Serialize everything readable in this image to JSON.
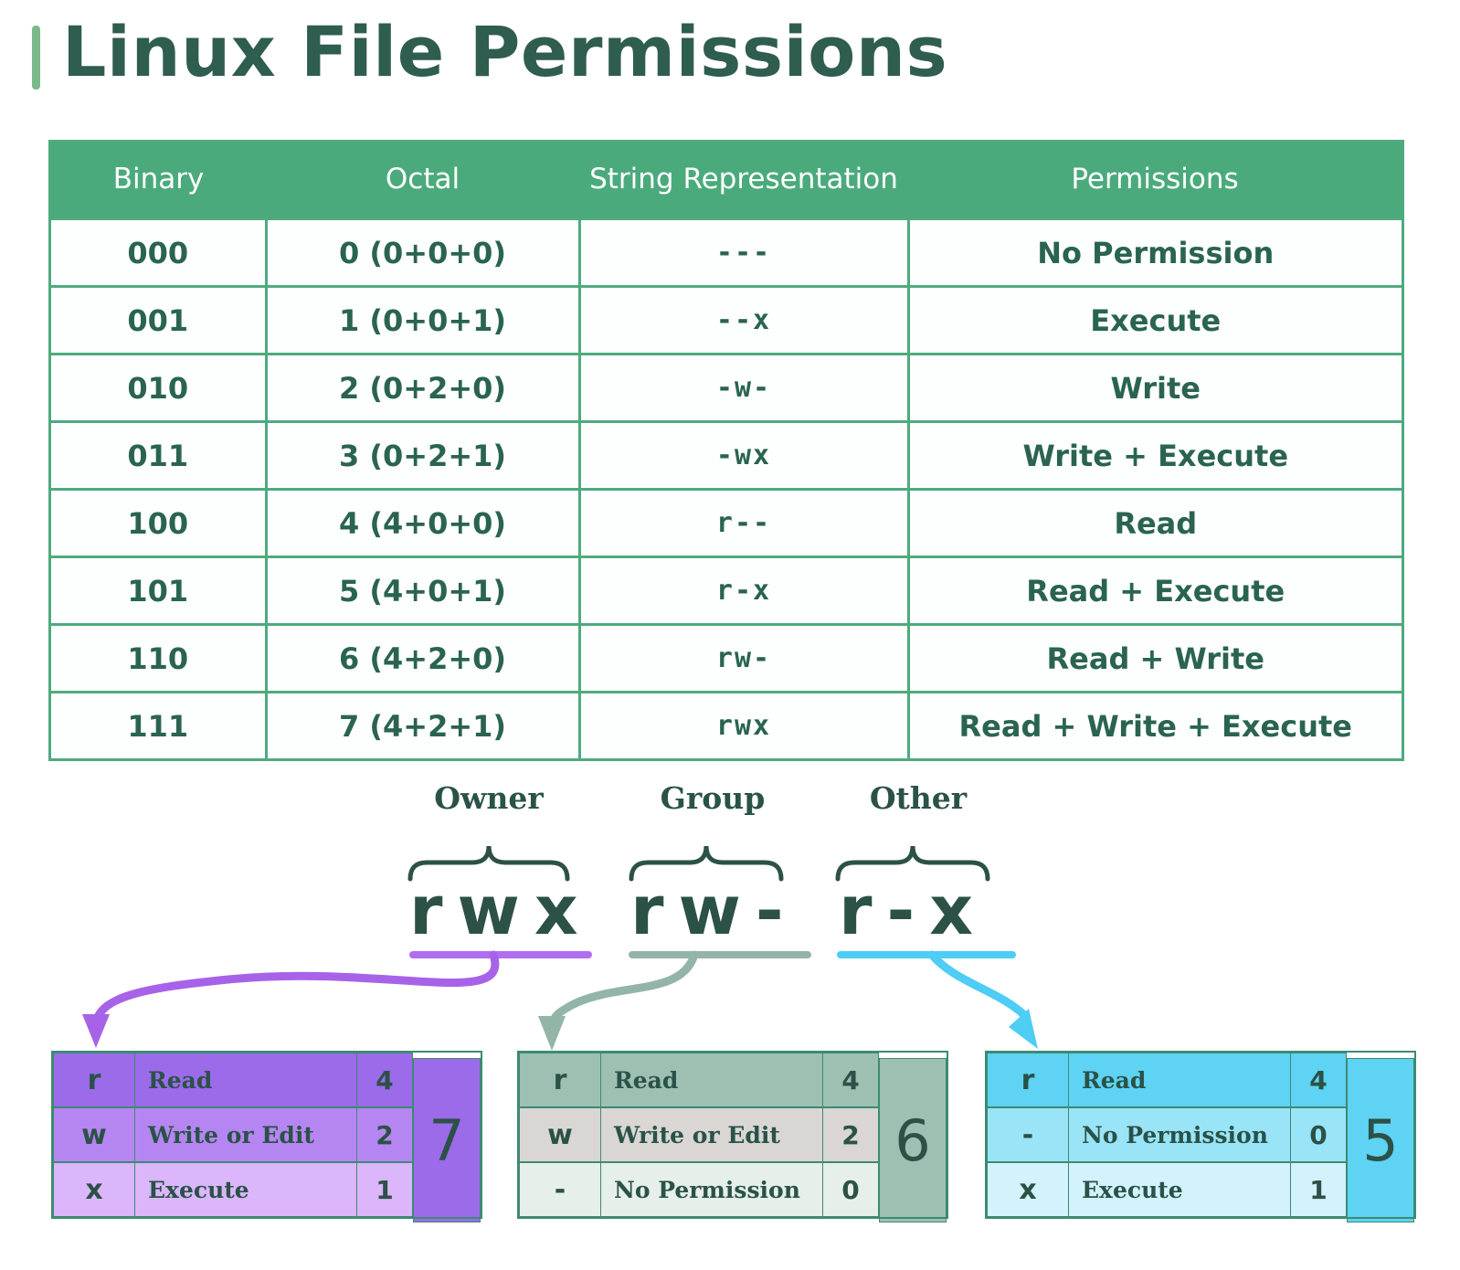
{
  "header": {
    "title": "Linux File Permissions",
    "accent_bar_color": "#7ab98a",
    "title_color": "#2f5d4f",
    "watermark": ""
  },
  "table": {
    "header_bg": "#4baa7c",
    "border_color": "#4faa7d",
    "columns": [
      "Binary",
      "Octal",
      "String Representation",
      "Permissions"
    ],
    "rows": [
      {
        "binary": "000",
        "octal": "0 (0+0+0)",
        "string": "---",
        "permissions": "No Permission"
      },
      {
        "binary": "001",
        "octal": "1 (0+0+1)",
        "string": "--x",
        "permissions": "Execute"
      },
      {
        "binary": "010",
        "octal": "2 (0+2+0)",
        "string": "-w-",
        "permissions": "Write"
      },
      {
        "binary": "011",
        "octal": "3 (0+2+1)",
        "string": "-wx",
        "permissions": "Write + Execute"
      },
      {
        "binary": "100",
        "octal": "4 (4+0+0)",
        "string": "r--",
        "permissions": "Read"
      },
      {
        "binary": "101",
        "octal": "5 (4+0+1)",
        "string": "r-x",
        "permissions": "Read + Execute"
      },
      {
        "binary": "110",
        "octal": "6 (4+2+0)",
        "string": "rw-",
        "permissions": "Read + Write"
      },
      {
        "binary": "111",
        "octal": "7 (4+2+1)",
        "string": "rwx",
        "permissions": "Read + Write + Execute"
      }
    ]
  },
  "diagram": {
    "groups": [
      {
        "label": "Owner",
        "chars": "rwx",
        "underline_color": "#b06ef0",
        "arrow_color": "#a763e8"
      },
      {
        "label": "Group",
        "chars": "rw-",
        "underline_color": "#93b5a8",
        "arrow_color": "#93b5a8"
      },
      {
        "label": "Other",
        "chars": "r-x",
        "underline_color": "#4ecdf5",
        "arrow_color": "#4ecdf5"
      }
    ]
  },
  "detail_boxes": [
    {
      "name": "owner",
      "total": "7",
      "accent": "#9b6bea",
      "row_shades": [
        "#9b6bea",
        "#b586f2",
        "#dbb6fa"
      ],
      "rows": [
        {
          "symbol": "r",
          "description": "Read",
          "value": "4"
        },
        {
          "symbol": "w",
          "description": "Write or Edit",
          "value": "2"
        },
        {
          "symbol": "x",
          "description": "Execute",
          "value": "1"
        }
      ]
    },
    {
      "name": "group",
      "total": "6",
      "accent": "#9dc0b3",
      "row_shades": [
        "#9dc0b3",
        "#d9d6d4",
        "#e6efe9"
      ],
      "rows": [
        {
          "symbol": "r",
          "description": "Read",
          "value": "4"
        },
        {
          "symbol": "w",
          "description": "Write or Edit",
          "value": "2"
        },
        {
          "symbol": "-",
          "description": "No Permission",
          "value": "0"
        }
      ]
    },
    {
      "name": "other",
      "total": "5",
      "accent": "#5ed3f3",
      "row_shades": [
        "#5ed3f3",
        "#9ae4f8",
        "#d2f2fc"
      ],
      "rows": [
        {
          "symbol": "r",
          "description": "Read",
          "value": "4"
        },
        {
          "symbol": "-",
          "description": "No Permission",
          "value": "0"
        },
        {
          "symbol": "x",
          "description": "Execute",
          "value": "1"
        }
      ]
    }
  ]
}
